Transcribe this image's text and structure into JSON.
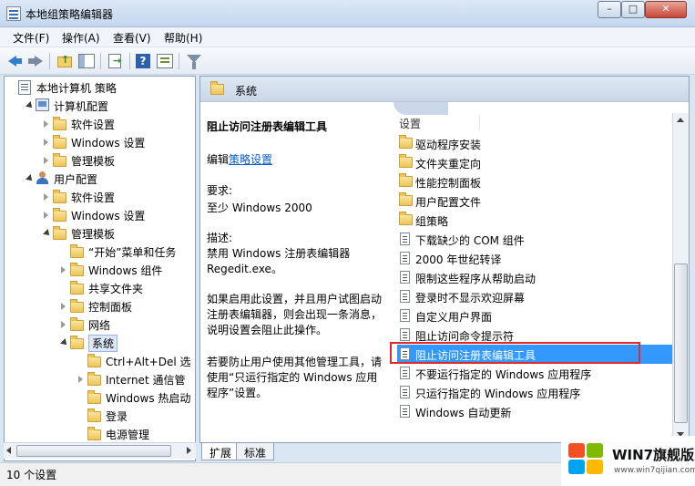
{
  "window": {
    "title": "本地组策略编辑器",
    "min": "–",
    "max": "□",
    "close": "✕"
  },
  "menu": [
    "文件(F)",
    "操作(A)",
    "查看(V)",
    "帮助(H)"
  ],
  "tree": [
    {
      "label": "本地计算机 策略",
      "depth": 0,
      "icon": "policy-icon",
      "expander": "none"
    },
    {
      "label": "计算机配置",
      "depth": 1,
      "icon": "computer-icon",
      "expander": "open"
    },
    {
      "label": "软件设置",
      "depth": 2,
      "icon": "folder-icon",
      "expander": "closed"
    },
    {
      "label": "Windows 设置",
      "depth": 2,
      "icon": "folder-icon",
      "expander": "closed"
    },
    {
      "label": "管理模板",
      "depth": 2,
      "icon": "folder-icon",
      "expander": "closed"
    },
    {
      "label": "用户配置",
      "depth": 1,
      "icon": "user-icon",
      "expander": "open"
    },
    {
      "label": "软件设置",
      "depth": 2,
      "icon": "folder-icon",
      "expander": "closed"
    },
    {
      "label": "Windows 设置",
      "depth": 2,
      "icon": "folder-icon",
      "expander": "closed"
    },
    {
      "label": "管理模板",
      "depth": 2,
      "icon": "folder-icon",
      "expander": "open"
    },
    {
      "label": "“开始”菜单和任务",
      "depth": 3,
      "icon": "folder-icon",
      "expander": "none"
    },
    {
      "label": "Windows 组件",
      "depth": 3,
      "icon": "folder-icon",
      "expander": "closed"
    },
    {
      "label": "共享文件夹",
      "depth": 3,
      "icon": "folder-icon",
      "expander": "none"
    },
    {
      "label": "控制面板",
      "depth": 3,
      "icon": "folder-icon",
      "expander": "closed"
    },
    {
      "label": "网络",
      "depth": 3,
      "icon": "folder-icon",
      "expander": "closed"
    },
    {
      "label": "系统",
      "depth": 3,
      "icon": "folder-icon",
      "expander": "open",
      "selected": true
    },
    {
      "label": "Ctrl+Alt+Del 选",
      "depth": 4,
      "icon": "folder-icon",
      "expander": "none"
    },
    {
      "label": "Internet 通信管",
      "depth": 4,
      "icon": "folder-icon",
      "expander": "closed"
    },
    {
      "label": "Windows 热启动",
      "depth": 4,
      "icon": "folder-icon",
      "expander": "none"
    },
    {
      "label": "登录",
      "depth": 4,
      "icon": "folder-icon",
      "expander": "none"
    },
    {
      "label": "电源管理",
      "depth": 4,
      "icon": "folder-icon",
      "expander": "none"
    }
  ],
  "header": {
    "title": "系统"
  },
  "description": {
    "title": "阻止访问注册表编辑工具",
    "edit_prefix": "编辑",
    "edit_link": "策略设置",
    "req_label": "要求:",
    "req_value": "至少 Windows 2000",
    "desc_label": "描述:",
    "desc_line1": "禁用 Windows 注册表编辑器",
    "desc_line2": "Regedit.exe。",
    "p1_line1": "如果启用此设置，并且用户试图启动",
    "p1_line2": "注册表编辑器，则会出现一条消息，",
    "p1_line3": "说明设置会阻止此操作。",
    "p2_line1": "若要防止用户使用其他管理工具，请",
    "p2_line2": "使用“只运行指定的 Windows 应用",
    "p2_line3": "程序”设置。"
  },
  "list": {
    "column": "设置",
    "items": [
      {
        "label": "驱动程序安装",
        "type": "folder"
      },
      {
        "label": "文件夹重定向",
        "type": "folder"
      },
      {
        "label": "性能控制面板",
        "type": "folder"
      },
      {
        "label": "用户配置文件",
        "type": "folder"
      },
      {
        "label": "组策略",
        "type": "folder"
      },
      {
        "label": "下载缺少的 COM 组件",
        "type": "setting"
      },
      {
        "label": "2000 年世纪转译",
        "type": "setting"
      },
      {
        "label": "限制这些程序从帮助启动",
        "type": "setting"
      },
      {
        "label": "登录时不显示欢迎屏幕",
        "type": "setting"
      },
      {
        "label": "自定义用户界面",
        "type": "setting"
      },
      {
        "label": "阻止访问命令提示符",
        "type": "setting"
      },
      {
        "label": "阻止访问注册表编辑工具",
        "type": "setting",
        "selected": true
      },
      {
        "label": "不要运行指定的 Windows 应用程序",
        "type": "setting"
      },
      {
        "label": "只运行指定的 Windows 应用程序",
        "type": "setting"
      },
      {
        "label": "Windows 自动更新",
        "type": "setting"
      }
    ]
  },
  "tabs": [
    "扩展",
    "标准"
  ],
  "status": "10 个设置",
  "watermark": {
    "brand": "WIN7旗舰版",
    "url": "www.win7qijian.com"
  }
}
